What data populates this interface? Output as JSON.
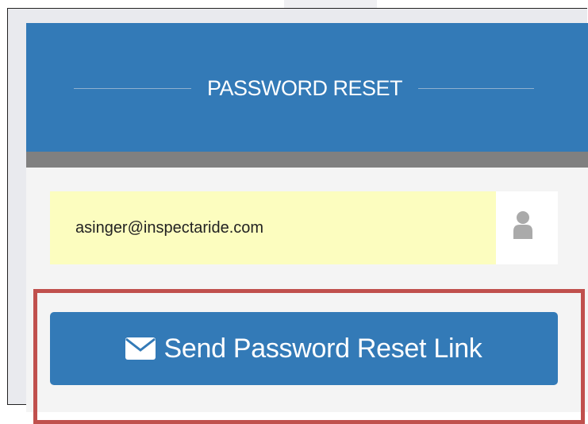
{
  "panel": {
    "title": "PASSWORD RESET"
  },
  "email_field": {
    "value": "asinger@inspectaride.com",
    "icon": "user-icon"
  },
  "send_button": {
    "label": "Send Password Reset Link",
    "icon": "envelope-icon"
  },
  "colors": {
    "primary": "#337ab7",
    "divider": "#808080",
    "autofill": "#fcfdbf",
    "highlight": "#c0504d"
  }
}
